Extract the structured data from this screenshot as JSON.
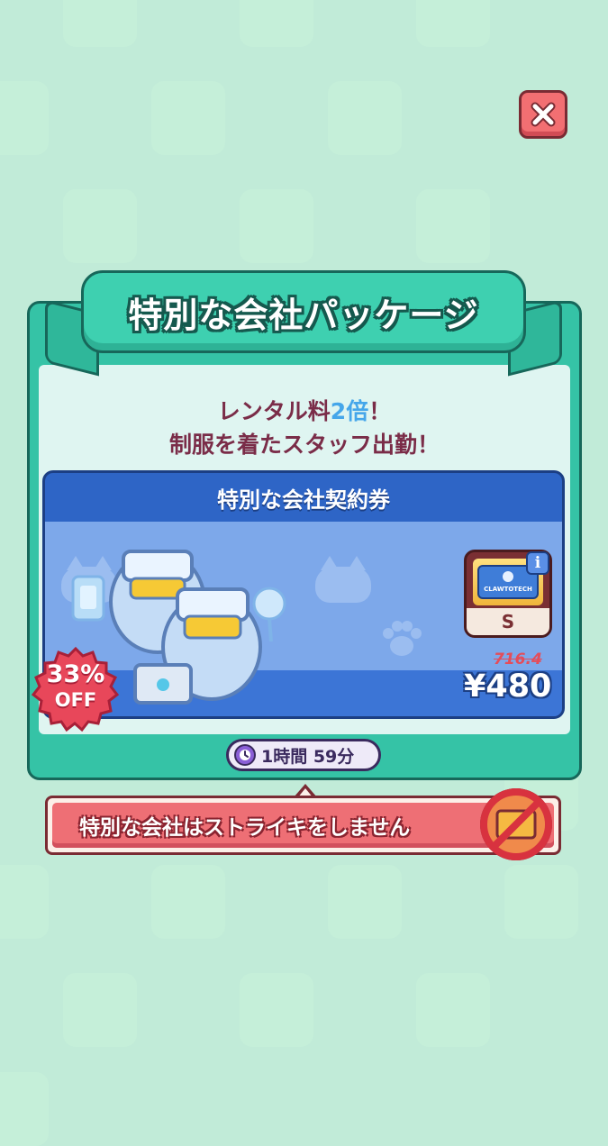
{
  "header": {
    "title": "特別な会社パッケージ"
  },
  "description": {
    "line1_prefix": "レンタル料",
    "line1_accent": "2倍",
    "line1_suffix": "！",
    "line2": "制服を着たスタッフ出勤！"
  },
  "offer": {
    "title": "特別な会社契約券",
    "discount_percent": "33%",
    "discount_label": "OFF",
    "item_logo_text": "CLAWTOTECH",
    "item_grade": "S",
    "original_price": "716.4",
    "price": "¥480"
  },
  "timer": {
    "text": "1時間 59分"
  },
  "notice": {
    "text": "特別な会社はストライキをしません"
  },
  "icons": [
    "close-icon",
    "info-icon",
    "clock-icon",
    "no-strike-icon"
  ],
  "colors": {
    "background": "#b3e6cf",
    "panel": "#35c3a6",
    "card": "#2e65c6",
    "accent": "#45a6ea",
    "discount": "#e8475a",
    "notice": "#ee6f75"
  }
}
